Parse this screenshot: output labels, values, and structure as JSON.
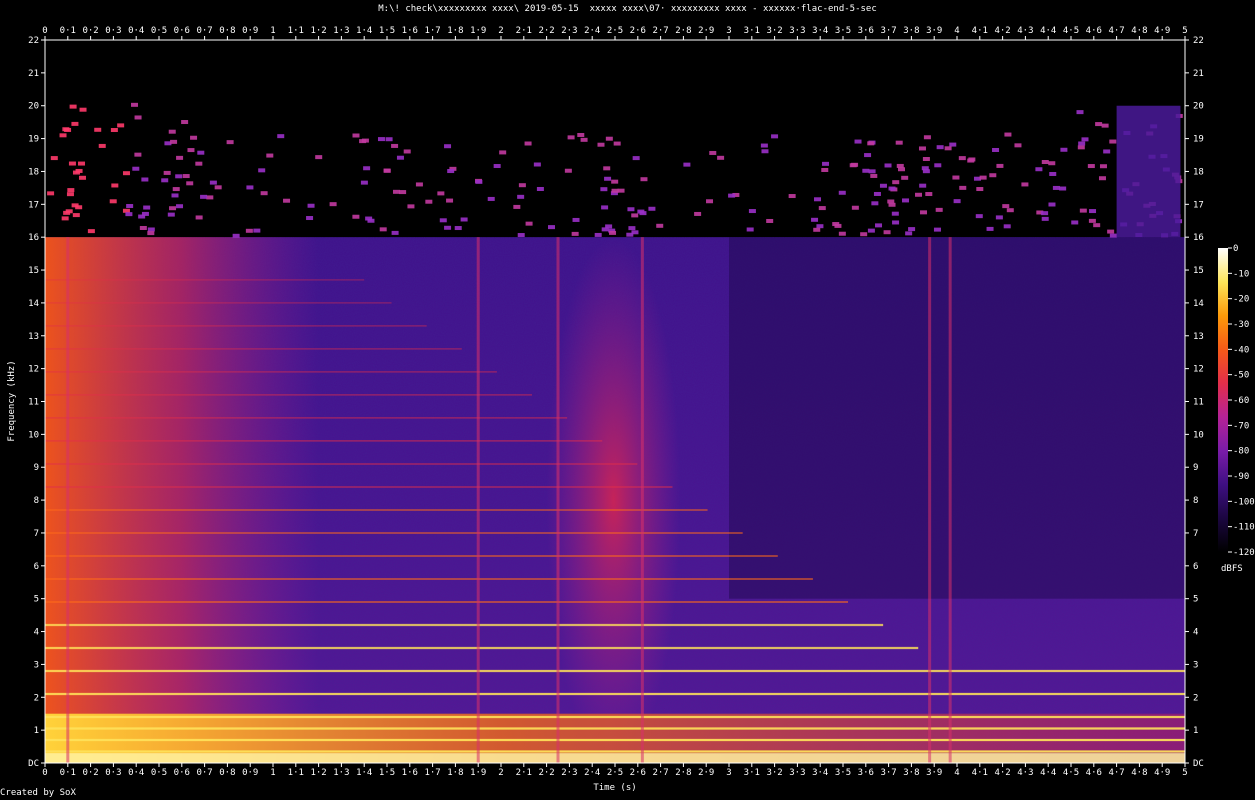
{
  "chart_data": {
    "type": "heatmap",
    "title": "M:\\! check\\xxxxxxxxx xxxx\\ 2019-05-15  xxxxx xxxx\\07· xxxxxxxxx xxxx - xxxxxx·flac-end-5-sec",
    "xlabel": "Time (s)",
    "ylabel": "Frequency (kHz)",
    "xlim": [
      0,
      5
    ],
    "ylim": [
      0,
      22
    ],
    "x_ticks": [
      "0",
      "0·1",
      "0·2",
      "0·3",
      "0·4",
      "0·5",
      "0·6",
      "0·7",
      "0·8",
      "0·9",
      "1",
      "1·1",
      "1·2",
      "1·3",
      "1·4",
      "1·5",
      "1·6",
      "1·7",
      "1·8",
      "1·9",
      "2",
      "2·1",
      "2·2",
      "2·3",
      "2·4",
      "2·5",
      "2·6",
      "2·7",
      "2·8",
      "2·9",
      "3",
      "3·1",
      "3·2",
      "3·3",
      "3·4",
      "3·5",
      "3·6",
      "3·7",
      "3·8",
      "3·9",
      "4",
      "4·1",
      "4·2",
      "4·3",
      "4·4",
      "4·5",
      "4·6",
      "4·7",
      "4·8",
      "4·9",
      "5"
    ],
    "y_ticks": [
      "DC",
      "1",
      "2",
      "3",
      "4",
      "5",
      "6",
      "7",
      "8",
      "9",
      "10",
      "11",
      "12",
      "13",
      "14",
      "15",
      "16",
      "17",
      "18",
      "19",
      "20",
      "21",
      "22"
    ],
    "colorbar": {
      "label": "dBFS",
      "ticks": [
        "0",
        "-10",
        "-20",
        "-30",
        "-40",
        "-50",
        "-60",
        "-70",
        "-80",
        "-90",
        "-100",
        "-110",
        "-120"
      ],
      "range": [
        -120,
        0
      ],
      "stops": [
        "#000000",
        "#1b0640",
        "#3e0f82",
        "#7a1ca8",
        "#b52296",
        "#e22e4a",
        "#f65a18",
        "#fb9a0a",
        "#fde55a",
        "#ffffff"
      ]
    },
    "features": {
      "lowpass_cutoff_khz": 16,
      "noise_floor_dbfs": -95,
      "harmonic_lines_khz": [
        0.35,
        0.7,
        1.05,
        1.4,
        2.1,
        2.8,
        3.5,
        4.2,
        4.9,
        5.6,
        6.3,
        7.0,
        7.7,
        8.4,
        9.1,
        9.8,
        10.5,
        11.2,
        11.9,
        12.6,
        13.3,
        14.0,
        14.7
      ],
      "transients_s": [
        0.1,
        1.9,
        2.25,
        2.62,
        3.88,
        3.97
      ],
      "high_energy_region_s": [
        2.2,
        2.7
      ]
    },
    "credit": "Created by SoX"
  }
}
